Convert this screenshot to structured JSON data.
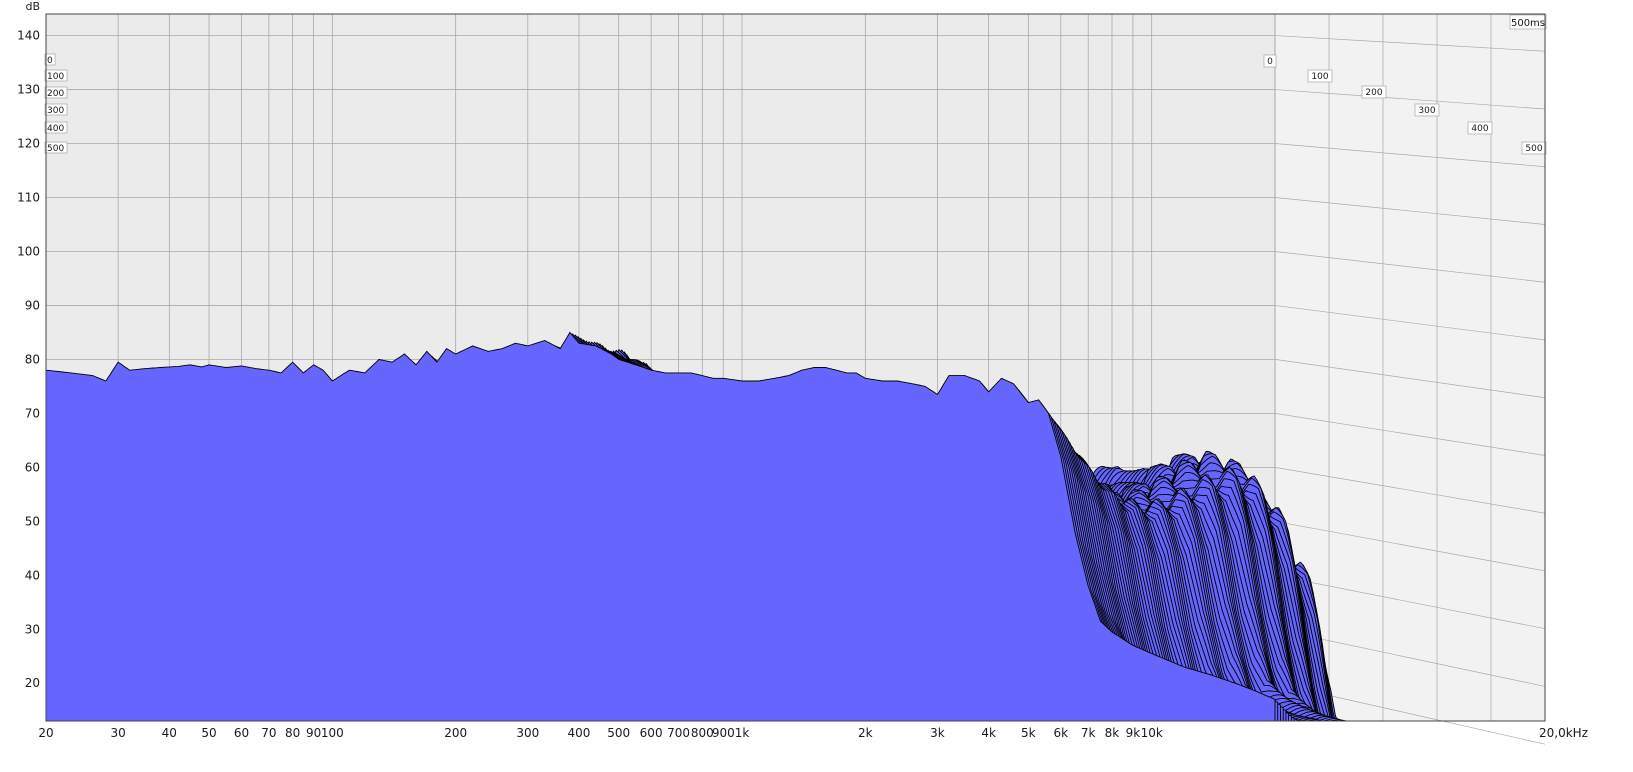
{
  "chart_data": {
    "type": "area",
    "chart_kind": "waterfall",
    "x_unit_label": "kHz",
    "y_unit_label": "dB",
    "x_scale": "log",
    "xlim": [
      20,
      20000
    ],
    "ylim": [
      13,
      144
    ],
    "y_ticks": [
      20,
      30,
      40,
      50,
      60,
      70,
      80,
      90,
      100,
      110,
      120,
      130,
      140
    ],
    "y_tick_labels": [
      "20",
      "30",
      "40",
      "50",
      "60",
      "70",
      "80",
      "90",
      "100",
      "110",
      "120",
      "130",
      "140"
    ],
    "x_ticks": [
      20,
      30,
      40,
      50,
      60,
      70,
      80,
      90,
      100,
      200,
      300,
      400,
      500,
      600,
      700,
      800,
      900,
      1000,
      2000,
      3000,
      4000,
      5000,
      6000,
      7000,
      8000,
      9000,
      10000,
      20000
    ],
    "x_tick_labels": [
      "20",
      "30",
      "40",
      "50",
      "60",
      "70",
      "80",
      "90",
      "100",
      "200",
      "300",
      "400",
      "500",
      "600",
      "700",
      "800",
      "900",
      "1k",
      "2k",
      "3k",
      "4k",
      "5k",
      "6k",
      "7k",
      "8k",
      "9k",
      "10k",
      "20,0kHz"
    ],
    "time_unit": "ms",
    "time_max_label": "500ms",
    "time_ticks": [
      0,
      100,
      200,
      300,
      400,
      500
    ],
    "time_tick_labels": [
      "0",
      "100",
      "200",
      "300",
      "400",
      "500"
    ],
    "grid": true,
    "fill_color": "#6666ff",
    "line_color": "#000000",
    "back_wall_color": "#ebebeb",
    "side_wall_color": "#f2f2f2",
    "grid_color": "#aaaaaa",
    "slice_count": 100,
    "front_slice": {
      "x": [
        20,
        23,
        26,
        28,
        30,
        32,
        35,
        38,
        42,
        45,
        48,
        50,
        55,
        60,
        65,
        70,
        75,
        80,
        85,
        90,
        95,
        100,
        110,
        120,
        130,
        140,
        150,
        160,
        170,
        180,
        190,
        200,
        220,
        240,
        260,
        280,
        300,
        330,
        360,
        380,
        400,
        440,
        480,
        500,
        550,
        600,
        650,
        700,
        750,
        800,
        850,
        900,
        1000,
        1100,
        1200,
        1300,
        1400,
        1500,
        1600,
        1700,
        1800,
        1900,
        2000,
        2200,
        2400,
        2600,
        2800,
        3000,
        3200,
        3500,
        3800,
        4000,
        4300,
        4600,
        5000,
        5300,
        5600,
        6000,
        6500,
        7000,
        7500,
        8000,
        9000,
        10000,
        12000,
        14000,
        16000,
        18000,
        20000
      ],
      "y": [
        78,
        77.5,
        77,
        76,
        79.5,
        78,
        78.3,
        78.5,
        78.7,
        79,
        78.6,
        79,
        78.5,
        78.8,
        78.3,
        78,
        77.5,
        79.5,
        77.5,
        79,
        78,
        76,
        78,
        77.5,
        80,
        79.5,
        81,
        79,
        81.5,
        79.5,
        82,
        81,
        82.5,
        81.5,
        82,
        83,
        82.5,
        83.5,
        82,
        85,
        83,
        82.5,
        81,
        80,
        79,
        78,
        77.5,
        77.5,
        77.5,
        77,
        76.5,
        76.5,
        76,
        76,
        76.5,
        77,
        78,
        78.5,
        78.5,
        78,
        77.5,
        77.5,
        76.5,
        76,
        76,
        75.5,
        75,
        73.5,
        77,
        77,
        76,
        74,
        76.5,
        75.5,
        72,
        72.5,
        70,
        62,
        48,
        38,
        31.5,
        29.5,
        27,
        25.5,
        23,
        21.5,
        20,
        18.5,
        17
      ]
    }
  }
}
